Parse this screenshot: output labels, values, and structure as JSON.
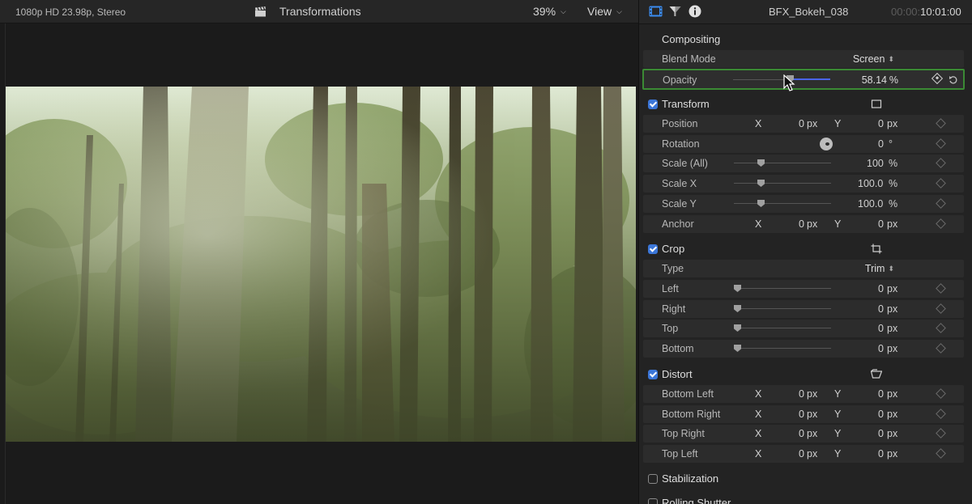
{
  "viewer": {
    "format": "1080p HD 23.98p, Stereo",
    "project_title": "Transformations",
    "zoom": "39%",
    "view_menu": "View"
  },
  "inspector": {
    "clip_name": "BFX_Bokeh_038",
    "timecode_dim": "00:00:",
    "timecode": "10:01:00",
    "tabs": [
      {
        "icon": "film-strip-icon"
      },
      {
        "icon": "filter-icon"
      },
      {
        "icon": "info-icon"
      }
    ],
    "compositing": {
      "title": "Compositing",
      "blend_mode_label": "Blend Mode",
      "blend_mode_value": "Screen",
      "opacity_label": "Opacity",
      "opacity_value": "58.14",
      "opacity_unit": "%",
      "opacity_level": 0.5814
    },
    "transform": {
      "title": "Transform",
      "enabled": true,
      "position": {
        "label": "Position",
        "x_label": "X",
        "x": "0",
        "x_unit": "px",
        "y_label": "Y",
        "y": "0",
        "y_unit": "px"
      },
      "rotation": {
        "label": "Rotation",
        "value": "0",
        "unit": "°"
      },
      "scale_all": {
        "label": "Scale (All)",
        "value": "100",
        "unit": "%"
      },
      "scale_x": {
        "label": "Scale X",
        "value": "100.0",
        "unit": "%"
      },
      "scale_y": {
        "label": "Scale Y",
        "value": "100.0",
        "unit": "%"
      },
      "anchor": {
        "label": "Anchor",
        "x_label": "X",
        "x": "0",
        "x_unit": "px",
        "y_label": "Y",
        "y": "0",
        "y_unit": "px"
      }
    },
    "crop": {
      "title": "Crop",
      "enabled": true,
      "type_label": "Type",
      "type_value": "Trim",
      "rows": [
        {
          "label": "Left",
          "value": "0",
          "unit": "px"
        },
        {
          "label": "Right",
          "value": "0",
          "unit": "px"
        },
        {
          "label": "Top",
          "value": "0",
          "unit": "px"
        },
        {
          "label": "Bottom",
          "value": "0",
          "unit": "px"
        }
      ]
    },
    "distort": {
      "title": "Distort",
      "enabled": true,
      "rows": [
        {
          "label": "Bottom Left",
          "x_label": "X",
          "x": "0",
          "x_unit": "px",
          "y_label": "Y",
          "y": "0",
          "y_unit": "px"
        },
        {
          "label": "Bottom Right",
          "x_label": "X",
          "x": "0",
          "x_unit": "px",
          "y_label": "Y",
          "y": "0",
          "y_unit": "px"
        },
        {
          "label": "Top Right",
          "x_label": "X",
          "x": "0",
          "x_unit": "px",
          "y_label": "Y",
          "y": "0",
          "y_unit": "px"
        },
        {
          "label": "Top Left",
          "x_label": "X",
          "x": "0",
          "x_unit": "px",
          "y_label": "Y",
          "y": "0",
          "y_unit": "px"
        }
      ]
    },
    "stabilization": {
      "title": "Stabilization",
      "enabled": false
    },
    "rolling_shutter": {
      "title": "Rolling Shutter",
      "enabled": false
    }
  },
  "colors": {
    "accent_blue": "#3b76d8",
    "highlight_green": "#3b8a34",
    "opacity_track": "#4a64e6"
  }
}
